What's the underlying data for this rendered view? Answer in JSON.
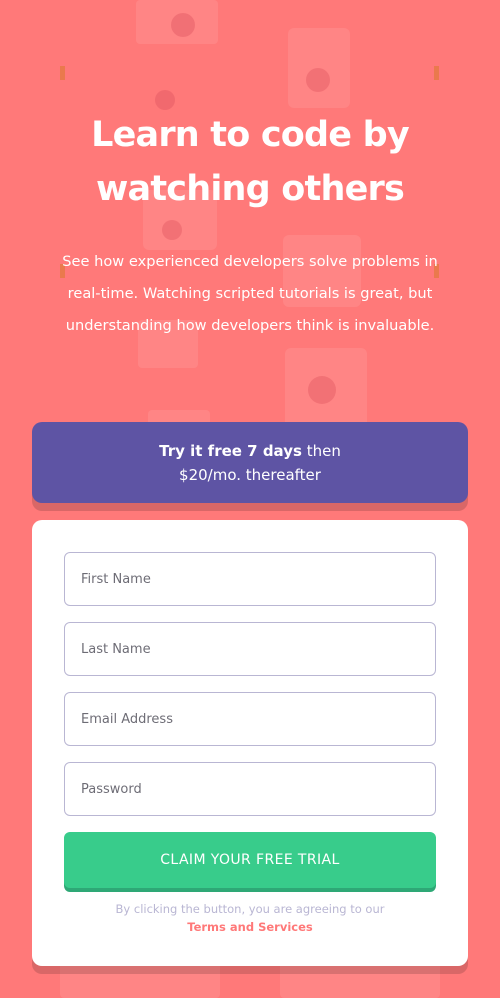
{
  "hero": {
    "headline_line1": "Learn to code by",
    "headline_line2": "watching others",
    "intro_line1": "See how experienced developers solve problems in",
    "intro_line2": "real-time. Watching scripted tutorials is great, but",
    "intro_line3": "understanding how developers think is invaluable."
  },
  "promo": {
    "bold": "Try it free 7 days",
    "after_bold": " then",
    "line2": "$20/mo. thereafter"
  },
  "form": {
    "first_name_placeholder": "First Name",
    "last_name_placeholder": "Last Name",
    "email_placeholder": "Email Address",
    "password_placeholder": "Password",
    "submit_label": "CLAIM YOUR FREE TRIAL",
    "terms_text": "By clicking the button, you are agreeing to our",
    "terms_link": "Terms and Services"
  },
  "colors": {
    "background": "#ff7979",
    "promo": "#5e54a4",
    "button": "#38cc8b",
    "input_border": "#b9b6d3",
    "text_dark": "#3d3b48"
  }
}
